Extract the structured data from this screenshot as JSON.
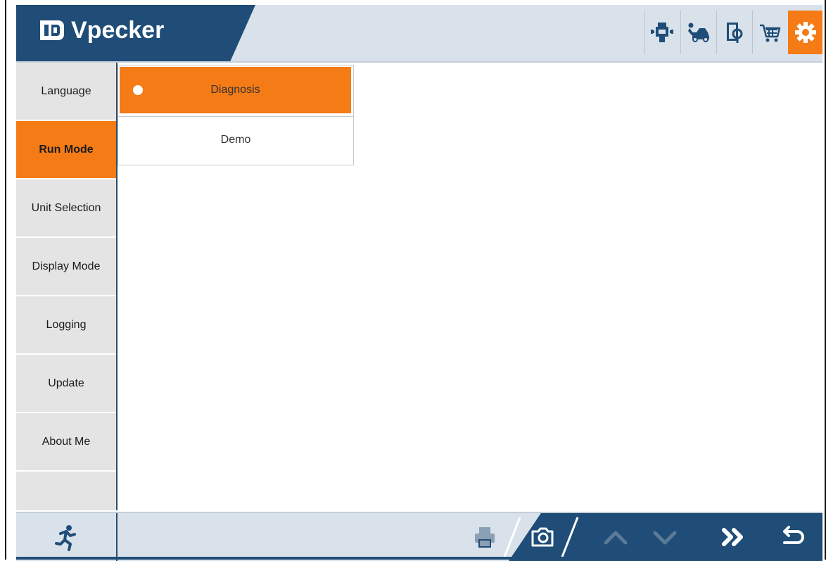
{
  "app": {
    "logo_text": "Vpecker"
  },
  "header": {
    "icons": [
      "diagnostic-connector-icon",
      "car-repair-icon",
      "manual-book-icon",
      "shopping-cart-icon",
      "settings-gear-icon"
    ],
    "active_icon": "settings-gear-icon",
    "accent_color": "#f47b16",
    "dark_color": "#1f4d78"
  },
  "sidebar": {
    "items": [
      {
        "label": "Language"
      },
      {
        "label": "Run Mode"
      },
      {
        "label": "Unit Selection"
      },
      {
        "label": "Display Mode"
      },
      {
        "label": "Logging"
      },
      {
        "label": "Update"
      },
      {
        "label": "About Me"
      }
    ],
    "active": "Run Mode"
  },
  "run_mode": {
    "options": [
      {
        "label": "Diagnosis",
        "selected": true
      },
      {
        "label": "Demo",
        "selected": false
      }
    ]
  },
  "footer": {
    "icons": [
      "exit-runner-icon",
      "print-icon",
      "camera-icon",
      "chevron-up-icon",
      "chevron-down-icon",
      "fast-forward-icon",
      "back-return-icon"
    ]
  }
}
